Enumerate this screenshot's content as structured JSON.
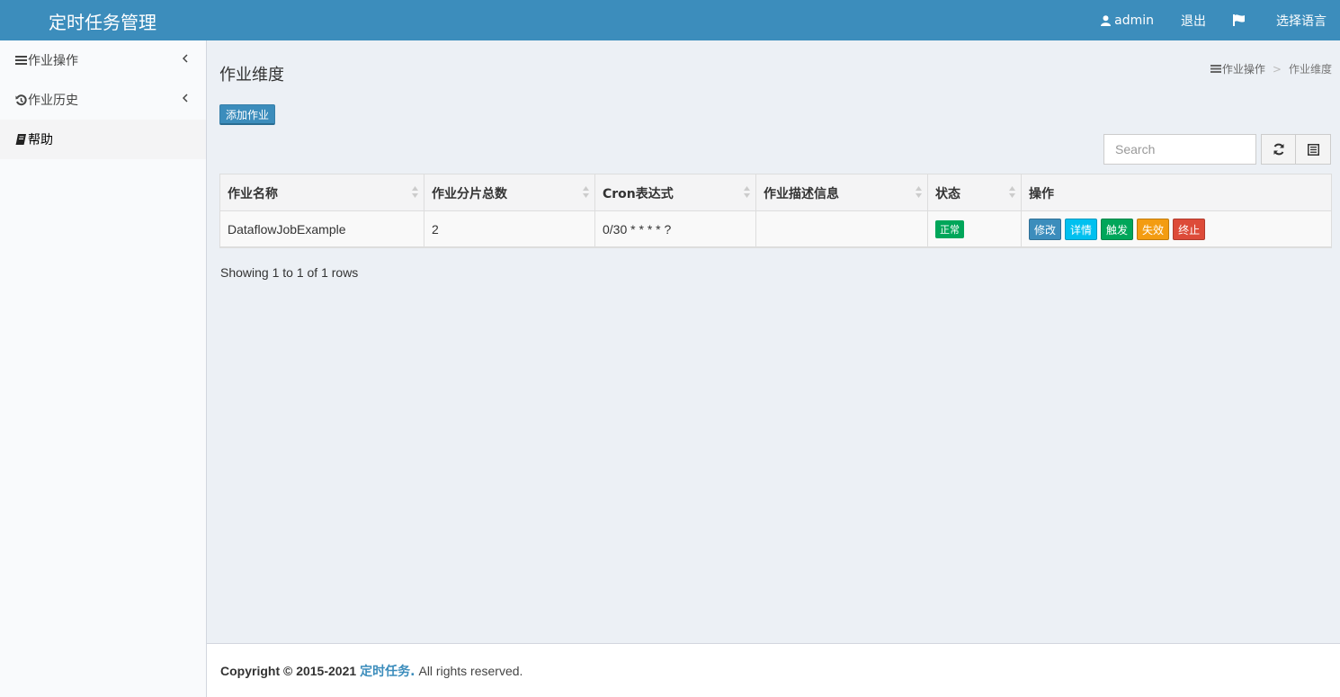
{
  "header": {
    "brand": "定时任务管理",
    "user": "admin",
    "logout": "退出",
    "language": "选择语言"
  },
  "sidebar": {
    "items": [
      {
        "label": "作业操作",
        "icon": "list-icon"
      },
      {
        "label": "作业历史",
        "icon": "history-icon"
      },
      {
        "label": "帮助",
        "icon": "book-icon"
      }
    ]
  },
  "main": {
    "title": "作业维度",
    "breadcrumb": {
      "parent": "作业操作",
      "current": "作业维度"
    },
    "add_button": "添加作业",
    "search_placeholder": "Search",
    "columns": [
      "作业名称",
      "作业分片总数",
      "Cron表达式",
      "作业描述信息",
      "状态",
      "操作"
    ],
    "rows": [
      {
        "name": "DataflowJobExample",
        "shards": "2",
        "cron": "0/30 * * * * ?",
        "description": "",
        "status": "正常",
        "actions": [
          "修改",
          "详情",
          "触发",
          "失效",
          "终止"
        ]
      }
    ],
    "showing": "Showing 1 to 1 of 1 rows"
  },
  "footer": {
    "copyright": "Copyright © 2015-2021",
    "brand": "定时任务.",
    "rights": "All rights reserved."
  },
  "colors": {
    "primary": "#3c8dbc",
    "info": "#00c0ef",
    "success": "#00a65a",
    "warning": "#f39c12",
    "danger": "#dd4b39"
  }
}
